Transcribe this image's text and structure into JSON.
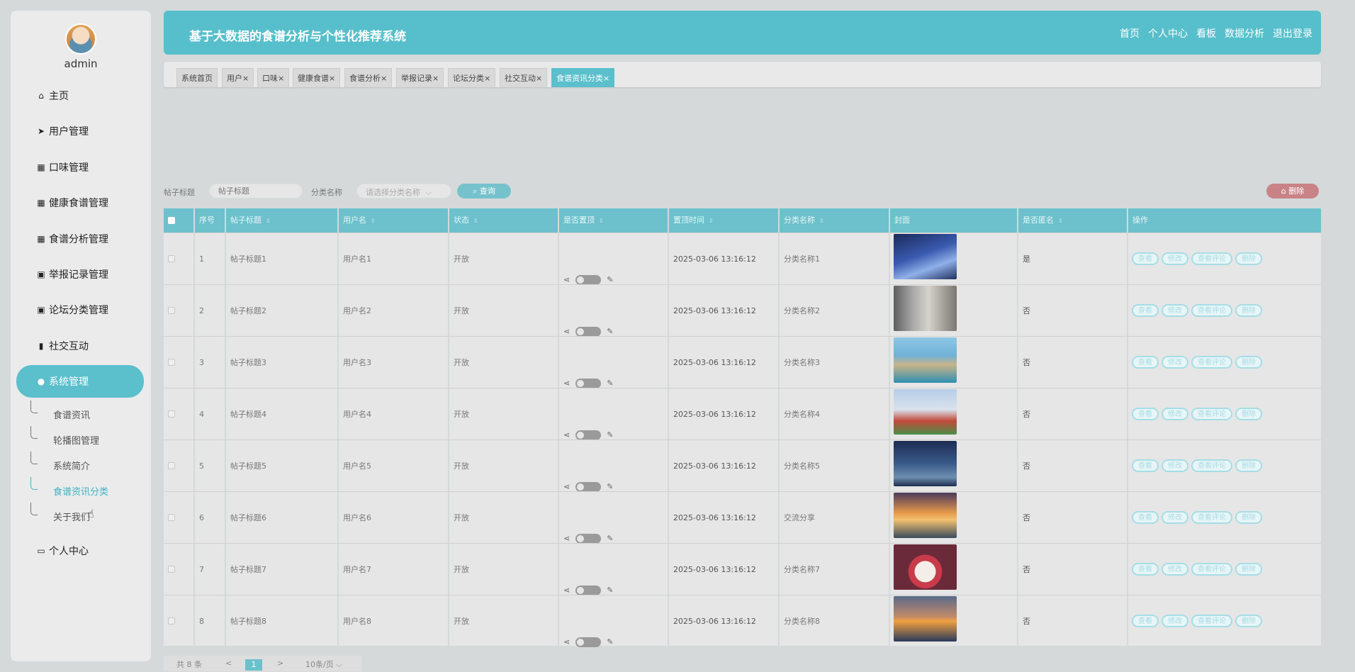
{
  "sidebar": {
    "username": "admin",
    "nav": [
      {
        "label": "主页",
        "icon": "home-icon",
        "glyph": "⌂"
      },
      {
        "label": "用户管理",
        "icon": "send-icon",
        "glyph": "➤"
      },
      {
        "label": "口味管理",
        "icon": "grid-icon",
        "glyph": "▦"
      },
      {
        "label": "健康食谱管理",
        "icon": "grid-icon",
        "glyph": "▦"
      },
      {
        "label": "食谱分析管理",
        "icon": "grid-icon",
        "glyph": "▦"
      },
      {
        "label": "举报记录管理",
        "icon": "clipboard-icon",
        "glyph": "▣"
      },
      {
        "label": "论坛分类管理",
        "icon": "clipboard-icon",
        "glyph": "▣"
      },
      {
        "label": "社交互动",
        "icon": "book-icon",
        "glyph": "▮"
      },
      {
        "label": "系统管理",
        "icon": "user-icon",
        "glyph": "●"
      }
    ],
    "sub": [
      "食谱资讯",
      "轮播图管理",
      "系统简介",
      "食谱资讯分类",
      "关于我们"
    ],
    "personal": {
      "label": "个人中心",
      "icon": "wallet-icon",
      "glyph": "▭"
    }
  },
  "header": {
    "title": "基于大数据的食谱分析与个性化推荐系统",
    "nav": [
      "首页",
      "个人中心",
      "看板",
      "数据分析",
      "退出登录"
    ]
  },
  "tabs": [
    "系统首页",
    "用户×",
    "口味×",
    "健康食谱×",
    "食谱分析×",
    "举报记录×",
    "论坛分类×",
    "社交互动×",
    "食谱资讯分类×"
  ],
  "search": {
    "title_label": "帖子标题",
    "title_placeholder": "帖子标题",
    "category_label": "分类名称",
    "category_placeholder": "请选择分类名称",
    "query_label": "查询",
    "delete_label": "删除"
  },
  "table": {
    "columns": [
      "序号",
      "帖子标题",
      "用户名",
      "状态",
      "是否置顶",
      "置顶时间",
      "分类名称",
      "封面",
      "是否匿名",
      "操作"
    ],
    "rows": [
      {
        "no": "1",
        "title": "帖子标题1",
        "user": "用户名1",
        "status": "开放",
        "time": "2025-03-06 13:16:12",
        "cat": "分类名称1",
        "anon": "是"
      },
      {
        "no": "2",
        "title": "帖子标题2",
        "user": "用户名2",
        "status": "开放",
        "time": "2025-03-06 13:16:12",
        "cat": "分类名称2",
        "anon": "否"
      },
      {
        "no": "3",
        "title": "帖子标题3",
        "user": "用户名3",
        "status": "开放",
        "time": "2025-03-06 13:16:12",
        "cat": "分类名称3",
        "anon": "否"
      },
      {
        "no": "4",
        "title": "帖子标题4",
        "user": "用户名4",
        "status": "开放",
        "time": "2025-03-06 13:16:12",
        "cat": "分类名称4",
        "anon": "否"
      },
      {
        "no": "5",
        "title": "帖子标题5",
        "user": "用户名5",
        "status": "开放",
        "time": "2025-03-06 13:16:12",
        "cat": "分类名称5",
        "anon": "否"
      },
      {
        "no": "6",
        "title": "帖子标题6",
        "user": "用户名6",
        "status": "开放",
        "time": "2025-03-06 13:16:12",
        "cat": "交流分享",
        "anon": "否"
      },
      {
        "no": "7",
        "title": "帖子标题7",
        "user": "用户名7",
        "status": "开放",
        "time": "2025-03-06 13:16:12",
        "cat": "分类名称7",
        "anon": "否"
      },
      {
        "no": "8",
        "title": "帖子标题8",
        "user": "用户名8",
        "status": "开放",
        "time": "2025-03-06 13:16:12",
        "cat": "分类名称8",
        "anon": "否"
      }
    ],
    "ops": [
      "查看",
      "修改",
      "查看评论",
      "删除"
    ]
  },
  "pager": {
    "total": "共 8 条",
    "prev": "<",
    "current": "1",
    "next": ">",
    "size": "10条/页"
  },
  "colors": {
    "accent": "#57bfcb",
    "danger": "#c98387",
    "bg": "#d5d9da"
  }
}
